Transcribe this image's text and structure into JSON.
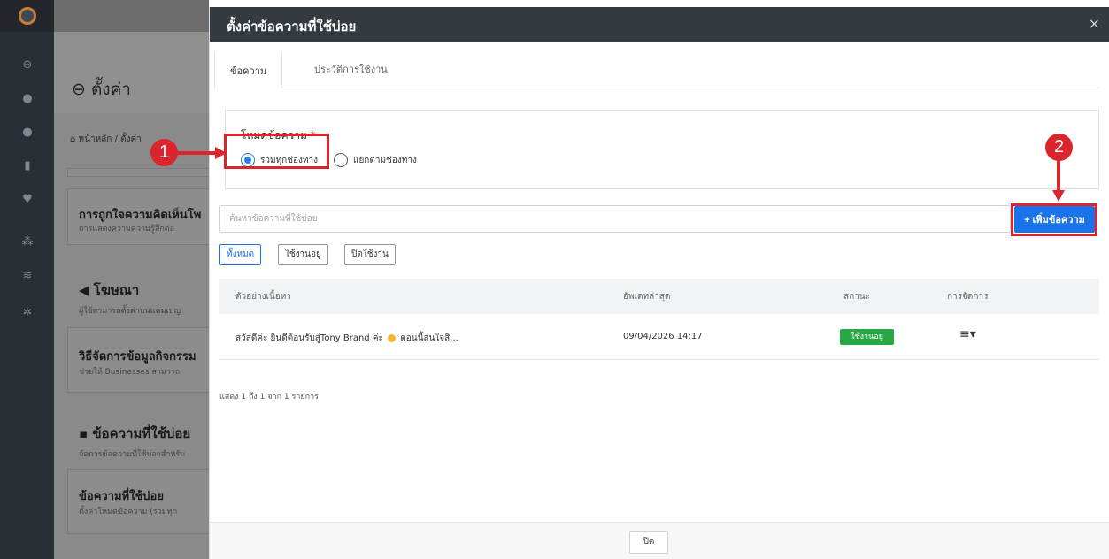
{
  "background_page": {
    "title": "ตั้งค่า",
    "breadcrumb": "หน้าหลัก / ตั้งค่า",
    "cards": [
      {
        "title": "การถูกใจความคิดเห็นโพ",
        "subtitle": "การแสดงความความรู้สึกต่อ"
      },
      {
        "title": "วิธีจัดการข้อมูลกิจกรรม",
        "subtitle": "ช่วยให้ Businesses สามารถ"
      },
      {
        "title": "ข้อความที่ใช้บ่อย",
        "subtitle": "ตั้งค่าโหมดข้อความ (รวมทุก"
      }
    ],
    "sections": [
      {
        "title": "โฆษณา",
        "subtitle": "ผู้ใช้สามารถตั้งค่าบนแคมเปญ"
      },
      {
        "title": "ข้อความที่ใช้บ่อย",
        "subtitle": "จัดการข้อความที่ใช้บ่อยสำหรับ"
      }
    ]
  },
  "modal": {
    "title": "ตั้งค่าข้อความที่ใช้บ่อย",
    "close_symbol": "×",
    "tabs": [
      {
        "label": "ข้อความ",
        "active": true
      },
      {
        "label": "ประวัติการใช้งาน",
        "active": false
      }
    ],
    "mode": {
      "label": "โหมดข้อความ",
      "required_mark": "*",
      "options": [
        {
          "label": "รวมทุกช่องทาง",
          "checked": true
        },
        {
          "label": "แยกตามช่องทาง",
          "checked": false
        }
      ]
    },
    "search": {
      "placeholder": "ค้นหาข้อความที่ใช้บ่อย",
      "value": ""
    },
    "add_button_label": "+ เพิ่มข้อความ",
    "filters": [
      {
        "label": "ทั้งหมด",
        "active": true
      },
      {
        "label": "ใช้งานอยู่",
        "active": false
      },
      {
        "label": "ปิดใช้งาน",
        "active": false
      }
    ],
    "table": {
      "headers": [
        "ตัวอย่างเนื้อหา",
        "อัพเดทล่าสุด",
        "สถานะ",
        "การจัดการ"
      ],
      "rows": [
        {
          "content_before": "สวัสดีค่ะ ยินดีต้อนรับสู่Tony Brand ค่ะ",
          "content_after": "ตอนนี้สนใจสิ...",
          "updated": "09/04/2026 14:17",
          "status": "ใช้งานอยู่",
          "actions_symbol": "≡▾"
        }
      ]
    },
    "paging_info": "แสดง 1 ถึง 1 จาก 1 รายการ",
    "footer_close_label": "ปิด"
  },
  "annotations": [
    {
      "number": "1"
    },
    {
      "number": "2"
    }
  ],
  "colors": {
    "header_bg": "#343a40",
    "primary": "#1a73e8",
    "success": "#28a745",
    "annotation_red": "#d9252b"
  }
}
